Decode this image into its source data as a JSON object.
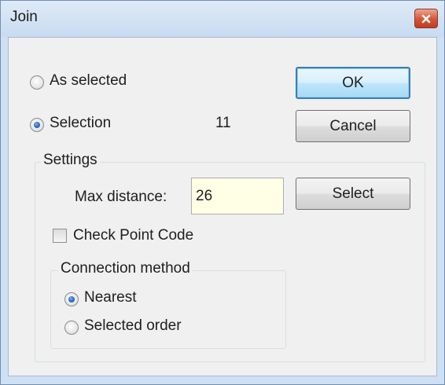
{
  "window": {
    "title": "Join"
  },
  "selection_mode": {
    "as_selected_label": "As selected",
    "selection_label": "Selection",
    "selection_count": "11",
    "selected": "Selection"
  },
  "buttons": {
    "ok_label": "OK",
    "cancel_label": "Cancel",
    "select_label": "Select"
  },
  "settings": {
    "group_title": "Settings",
    "max_distance_label": "Max distance:",
    "max_distance_value": "26",
    "check_point_code_label": "Check Point Code",
    "check_point_code_checked": false
  },
  "connection_method": {
    "group_title": "Connection method",
    "nearest_label": "Nearest",
    "selected_order_label": "Selected order",
    "selected": "Nearest"
  },
  "icons": {
    "close": "close-icon"
  },
  "colors": {
    "titlebar": "#cfe0f3",
    "close_button": "#d45436",
    "text_field_background": "#ffffe6",
    "default_button_border": "#3c7fb1"
  }
}
